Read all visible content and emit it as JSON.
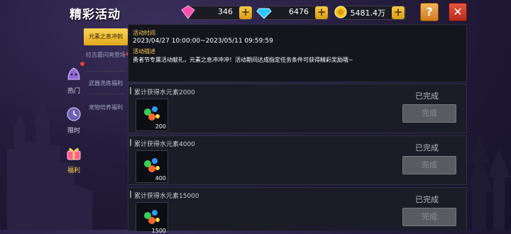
{
  "header": {
    "title": "精彩活动",
    "resources": [
      {
        "icon": "pink-gem-icon",
        "value": "346"
      },
      {
        "icon": "blue-diamond-icon",
        "value": "6476"
      },
      {
        "icon": "gold-coin-icon",
        "value": "5481.4万"
      }
    ],
    "help_label": "?",
    "close_label": "✕"
  },
  "nav": [
    {
      "label": "热门",
      "icon": "slime-icon",
      "badge": true
    },
    {
      "label": "限时",
      "icon": "clock-icon",
      "badge": false
    },
    {
      "label": "福利",
      "icon": "gift-icon",
      "badge": false,
      "active": true
    }
  ],
  "sub_menu": [
    {
      "label": "元素之息冲刺",
      "active": true
    },
    {
      "label": "拉吉葛闪亮登场",
      "badge": true
    },
    {
      "label": "武器洗练福利"
    },
    {
      "label": "宠物培养福利"
    }
  ],
  "info": {
    "time_label": "活动时间",
    "time_value": "2023/04/27 10:00:00~2023/05/11 09:59:59",
    "desc_label": "活动描述",
    "desc_value": "勇者节专属活动献礼，元素之息冲冲冲！活动期间达成指定任务条件可获得精彩奖励哦~"
  },
  "tasks": [
    {
      "name": "累计获得水元素2000",
      "reward_qty": "200",
      "status": "已完成",
      "button": "完成"
    },
    {
      "name": "累计获得水元素4000",
      "reward_qty": "400",
      "status": "已完成",
      "button": "完成"
    },
    {
      "name": "累计获得水元素15000",
      "reward_qty": "1500",
      "status": "已完成",
      "button": "完成"
    }
  ],
  "colors": {
    "accent": "#ffd34d",
    "close": "#d23a27",
    "help": "#e6932f",
    "panel": "#1c1c28"
  }
}
